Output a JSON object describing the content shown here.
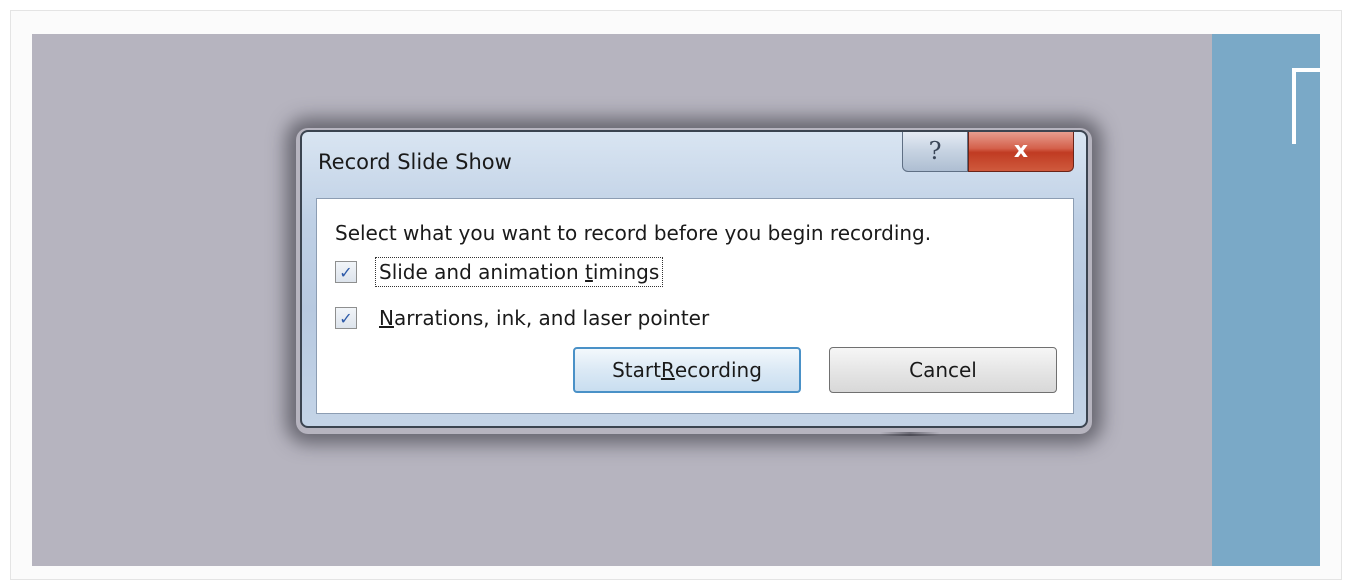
{
  "dialog": {
    "title": "Record Slide Show",
    "help_glyph": "?",
    "close_glyph": "x",
    "prompt": "Select what you want to record before you begin recording.",
    "options": [
      {
        "label_pre": "Slide and animation ",
        "label_accel": "t",
        "label_post": "imings",
        "checked": true,
        "focused": true
      },
      {
        "label_pre": "",
        "label_accel": "N",
        "label_post": "arrations, ink, and laser pointer",
        "checked": true,
        "focused": false
      }
    ],
    "check_glyph": "✓",
    "buttons": {
      "start_pre": "Start ",
      "start_accel": "R",
      "start_post": "ecording",
      "cancel": "Cancel"
    }
  },
  "colors": {
    "backdrop": "#b6b4bf",
    "side_panel": "#7aa9c7",
    "close_button": "#c03b22",
    "default_button_border": "#4a91c7"
  }
}
